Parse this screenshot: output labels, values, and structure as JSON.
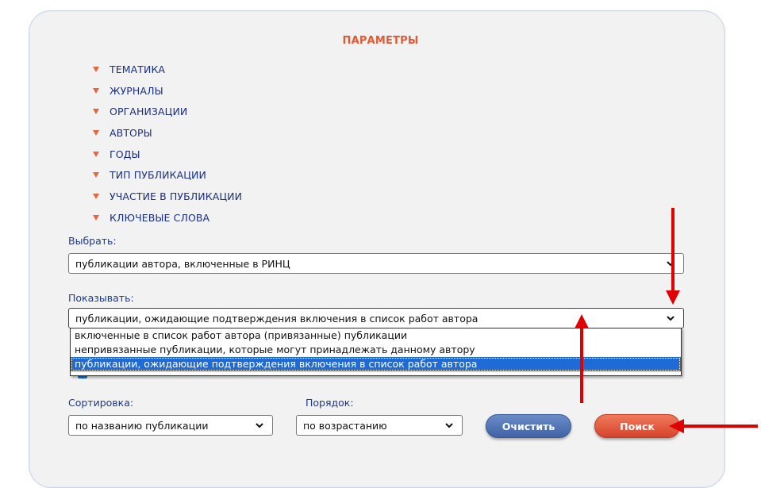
{
  "panel": {
    "title": "ПАРАМЕТРЫ"
  },
  "categories": [
    "ТЕМАТИКА",
    "ЖУРНАЛЫ",
    "ОРГАНИЗАЦИИ",
    "АВТОРЫ",
    "ГОДЫ",
    "ТИП ПУБЛИКАЦИИ",
    "УЧАСТИЕ В ПУБЛИКАЦИИ",
    "КЛЮЧЕВЫЕ СЛОВА"
  ],
  "select_field": {
    "label": "Выбрать:",
    "value": "публикации автора, включенные в РИНЦ"
  },
  "show_field": {
    "label": "Показывать:",
    "value": "публикации, ожидающие подтверждения включения в список работ автора",
    "options": [
      "включенные в список работ автора (привязанные) публикации",
      "непривязанные публикации, которые могут принадлежать данному автору",
      "публикации, ожидающие подтверждения включения в список работ автора"
    ],
    "selected_index": 2
  },
  "sort_field": {
    "label": "Сортировка:",
    "value": "по названию публикации"
  },
  "order_field": {
    "label": "Порядок:",
    "value": "по возрастанию"
  },
  "buttons": {
    "clear": "Очистить",
    "search": "Поиск"
  },
  "colors": {
    "accent": "#e05a34",
    "label": "#1a3a8c",
    "selected": "#1e6ad6",
    "annotation": "#e00000"
  },
  "icons": {
    "category_marker": "triangle-down-icon",
    "select_chevron": "chevron-down-icon"
  }
}
